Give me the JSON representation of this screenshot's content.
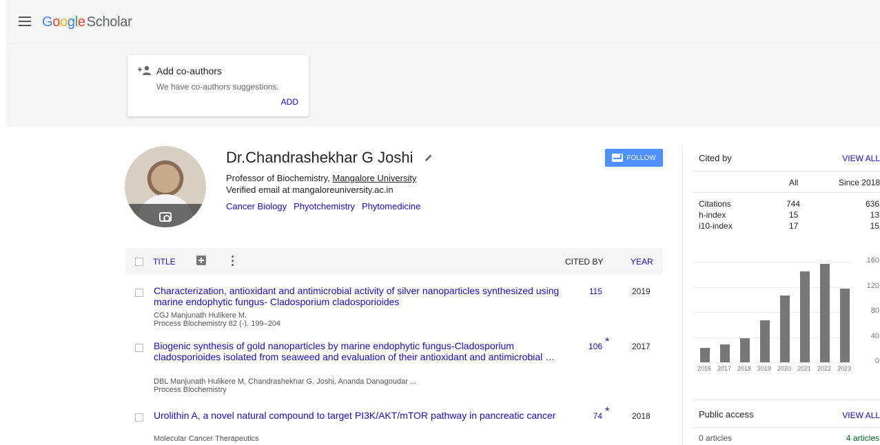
{
  "header": {
    "logo_letters": [
      "G",
      "o",
      "o",
      "g",
      "l",
      "e"
    ],
    "logo_scholar": "Scholar"
  },
  "coauthors": {
    "title": "Add co-authors",
    "subtitle": "We have co-authors suggestions.",
    "add_label": "ADD"
  },
  "profile": {
    "name": "Dr.Chandrashekhar G Joshi",
    "affiliation_prefix": "Professor of Biochemistry, ",
    "affiliation_link": "Mangalore University",
    "email": "Verified email at mangaloreuniversity.ac.in",
    "interests": [
      "Cancer Biology",
      "Phyotchemistry",
      "Phytomedicine"
    ],
    "follow_label": "FOLLOW"
  },
  "table": {
    "col_title": "TITLE",
    "col_cited": "CITED BY",
    "col_year": "YEAR",
    "rows": [
      {
        "title": "Characterization, antioxidant and antimicrobial activity of silver nanoparticles synthesized using marine endophytic fungus- Cladosporium cladosporioides",
        "authors": "CGJ Manjunath Hulikere M.",
        "venue": "Process Biochemistry 82 (-), 199–204",
        "cited": "115",
        "star": "",
        "year": "2019"
      },
      {
        "title": "Biogenic synthesis of gold nanoparticles by marine endophytic fungus-Cladosporium cladosporioides isolated from seaweed and evaluation of their antioxidant and antimicrobial …",
        "authors": "DBL Manjunath Hulikere M, Chandrashekhar G. Joshi, Ananda Danagoudar ...",
        "venue": "Process Biochemistry",
        "cited": "106",
        "star": "*",
        "year": "2017"
      },
      {
        "title": "Urolithin A, a novel natural compound to target PI3K/AKT/mTOR pathway in pancreatic cancer",
        "authors": "",
        "venue": "Molecular Cancer Therapeutics",
        "cited": "74",
        "star": "*",
        "year": "2018"
      }
    ]
  },
  "cited_by": {
    "title": "Cited by",
    "view_all": "VIEW ALL",
    "col_all": "All",
    "col_since": "Since 2018",
    "stats": [
      {
        "label": "Citations",
        "all": "744",
        "since": "636"
      },
      {
        "label": "h-index",
        "all": "15",
        "since": "13"
      },
      {
        "label": "i10-index",
        "all": "17",
        "since": "15"
      }
    ]
  },
  "chart_data": {
    "type": "bar",
    "categories": [
      "2016",
      "2017",
      "2018",
      "2019",
      "2020",
      "2021",
      "2022",
      "2023"
    ],
    "values": [
      23,
      29,
      38,
      67,
      106,
      145,
      157,
      117
    ],
    "ylim": [
      0,
      160
    ],
    "yticks": [
      "0",
      "40",
      "80",
      "120",
      "160"
    ],
    "bar_color": "#777777"
  },
  "public_access": {
    "title": "Public access",
    "view_all": "VIEW ALL",
    "left": "0 articles",
    "right": "4 articles"
  },
  "colors": {
    "link": "#1a0dab",
    "follow_button": "#4d90fe",
    "header_bg": "#f5f5f5",
    "available": "#006621"
  }
}
